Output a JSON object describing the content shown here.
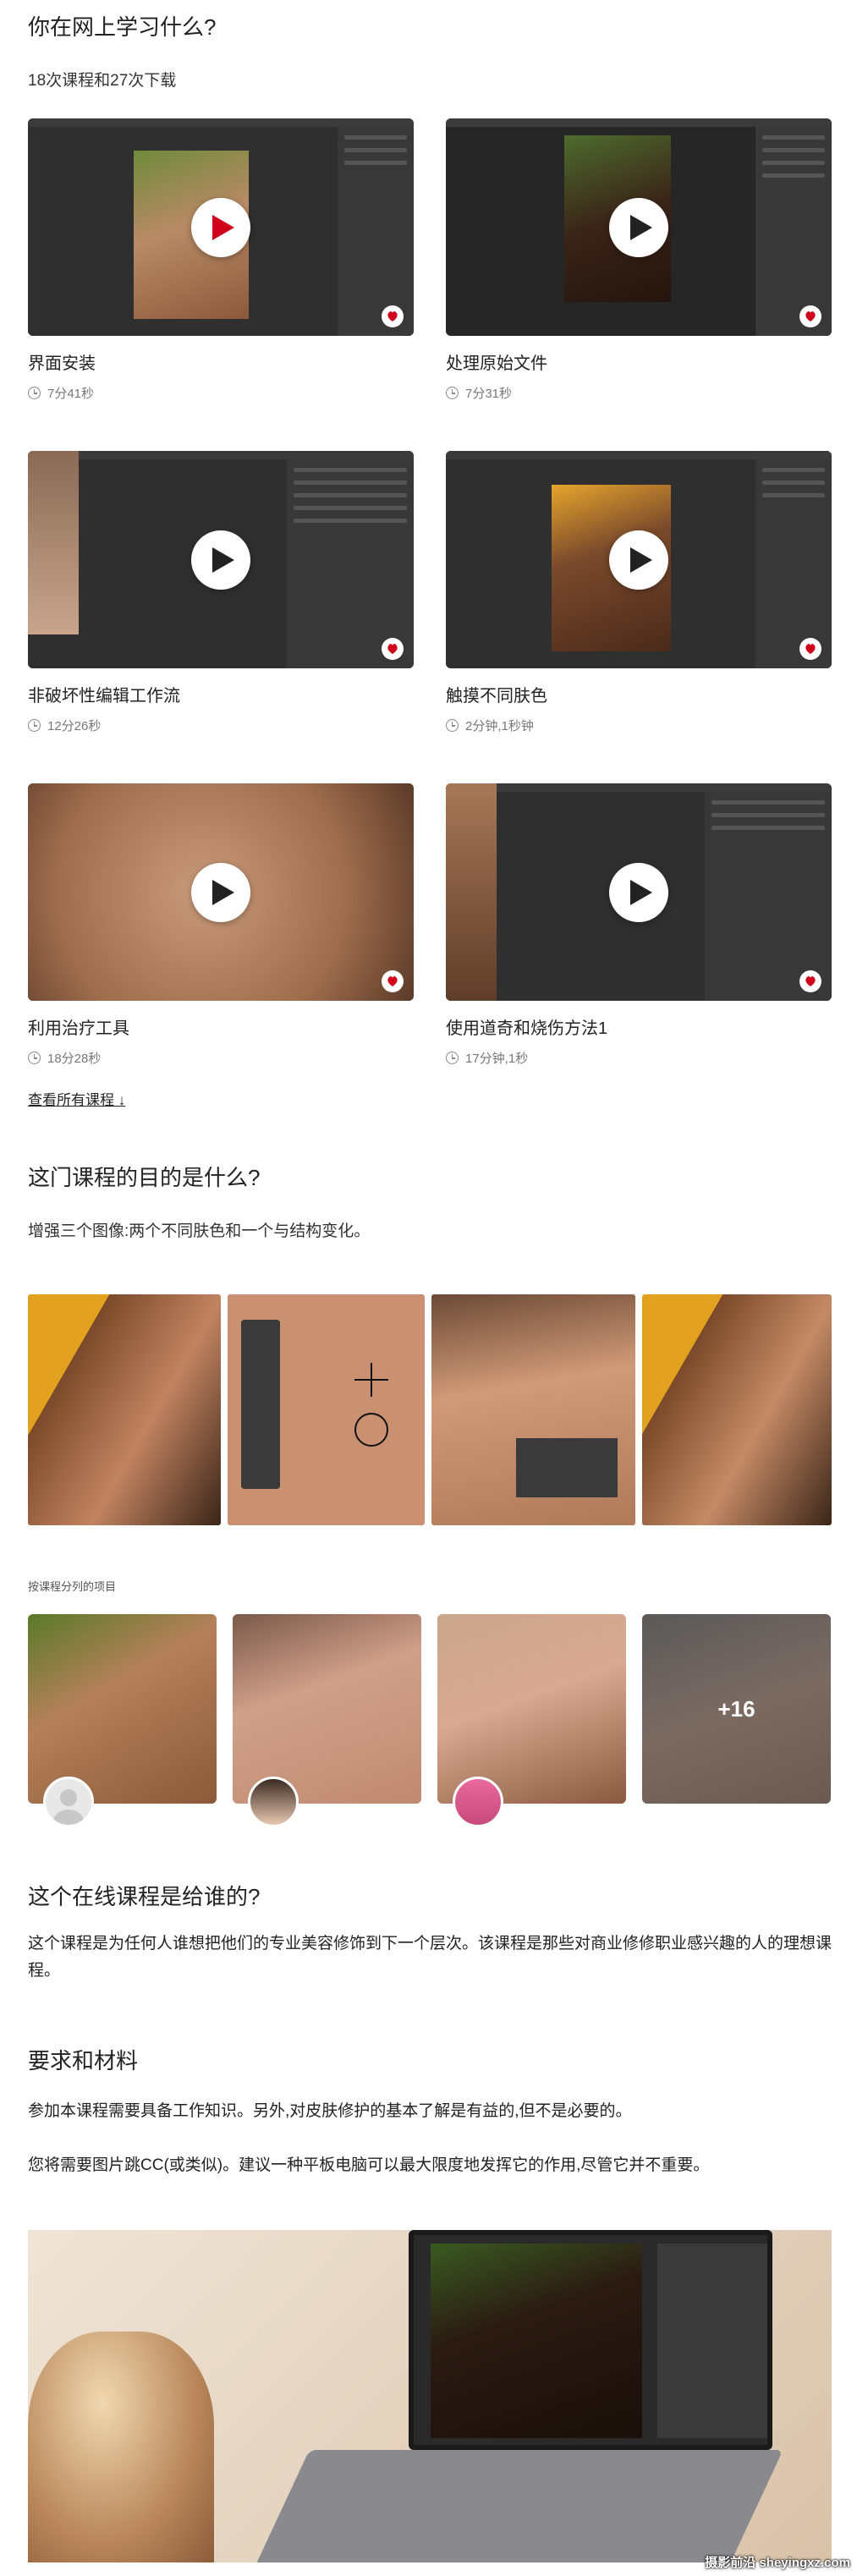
{
  "learn": {
    "title": "你在网上学习什么?",
    "subtitle": "18次课程和27次下载",
    "lessons": [
      {
        "title": "界面安装",
        "duration": "7分41秒"
      },
      {
        "title": "处理原始文件",
        "duration": "7分31秒"
      },
      {
        "title": "非破坏性编辑工作流",
        "duration": "12分26秒"
      },
      {
        "title": "触摸不同肤色",
        "duration": "2分钟,1秒钟"
      },
      {
        "title": "利用治疗工具",
        "duration": "18分28秒"
      },
      {
        "title": "使用道奇和烧伤方法1",
        "duration": "17分钟,1秒"
      }
    ],
    "see_all": "查看所有课程 ↓"
  },
  "purpose": {
    "title": "这门课程的目的是什么?",
    "text": "增强三个图像:两个不同肤色和一个与结构变化。"
  },
  "projects": {
    "label": "按课程分列的项目",
    "more_count": "+16"
  },
  "audience": {
    "title": "这个在线课程是给谁的?",
    "text": "这个课程是为任何人谁想把他们的专业美容修饰到下一个层次。该课程是那些对商业修修职业感兴趣的人的理想课程。"
  },
  "requirements": {
    "title": "要求和材料",
    "p1": "参加本课程需要具备工作知识。另外,对皮肤修护的基本了解是有益的,但不是必要的。",
    "p2": "您将需要图片跳CC(或类似)。建议一种平板电脑可以最大限度地发挥它的作用,尽管它并不重要。"
  },
  "watermark": "摄影前沿 sheyingxz.com",
  "colors": {
    "accent": "#e23b3b",
    "text": "#222222",
    "muted": "#777777"
  }
}
